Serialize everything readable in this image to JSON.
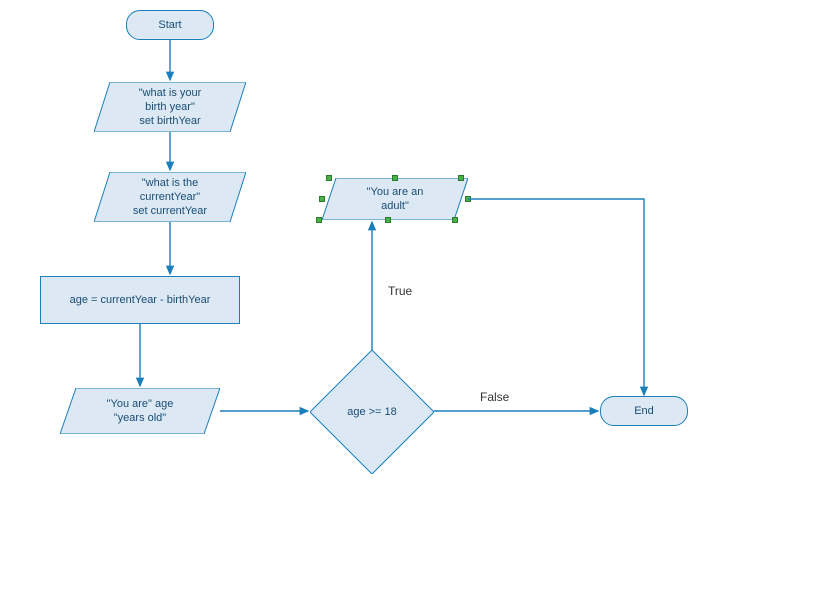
{
  "nodes": {
    "start": {
      "text": "Start"
    },
    "input1": {
      "text": "\"what is your\nbirth year\"\nset birthYear"
    },
    "input2": {
      "text": "\"what is the\ncurrentYear\"\nset currentYear"
    },
    "process": {
      "text": "age = currentYear - birthYear"
    },
    "output1": {
      "text": "\"You are\" age\n\"years old\""
    },
    "decision": {
      "text": "age >= 18"
    },
    "output2": {
      "text": "\"You are an\nadult\""
    },
    "end": {
      "text": "End"
    }
  },
  "edges": {
    "true_label": "True",
    "false_label": "False"
  },
  "colors": {
    "fill": "#dce9f5",
    "stroke": "#1a7fba"
  }
}
